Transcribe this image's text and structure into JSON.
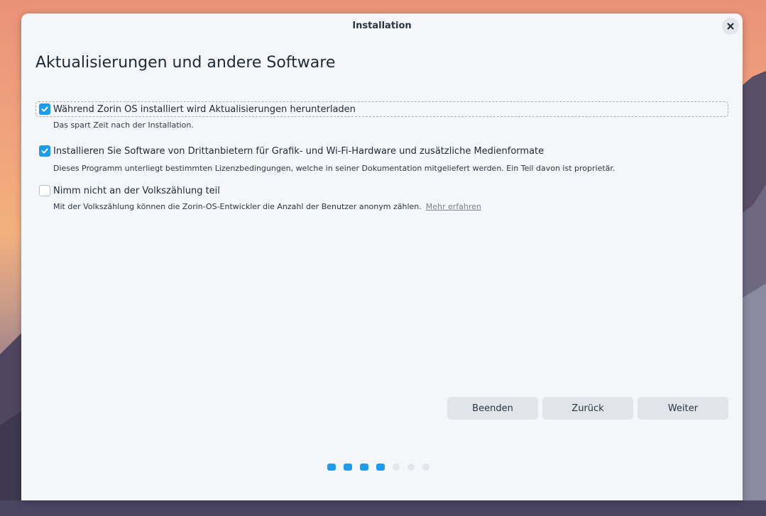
{
  "window": {
    "title": "Installation"
  },
  "heading": "Aktualisierungen und andere Software",
  "options": [
    {
      "label": "Während Zorin OS installiert wird Aktualisierungen herunterladen",
      "description": "Das spart Zeit nach der Installation.",
      "checked": true
    },
    {
      "label": "Installieren Sie Software von Drittanbietern für Grafik- und Wi-Fi-Hardware und zusätzliche Medienformate",
      "description": "Dieses Programm unterliegt bestimmten Lizenzbedingungen, welche in seiner Dokumentation mitgeliefert werden. Ein Teil davon ist proprietär.",
      "checked": true
    },
    {
      "label": "Nimm nicht an der Volkszählung teil",
      "description": "Mit der Volkszählung können die Zorin-OS-Entwickler die Anzahl der Benutzer anonym zählen.",
      "link": "Mehr erfahren",
      "checked": false
    }
  ],
  "buttons": {
    "quit": "Beenden",
    "back": "Zurück",
    "next": "Weiter"
  },
  "progress": {
    "completed_steps": 4,
    "total_steps": 7
  },
  "colors": {
    "accent": "#1b9cec",
    "window_bg": "#f4f6f9",
    "button_bg": "#e1e4e9"
  }
}
